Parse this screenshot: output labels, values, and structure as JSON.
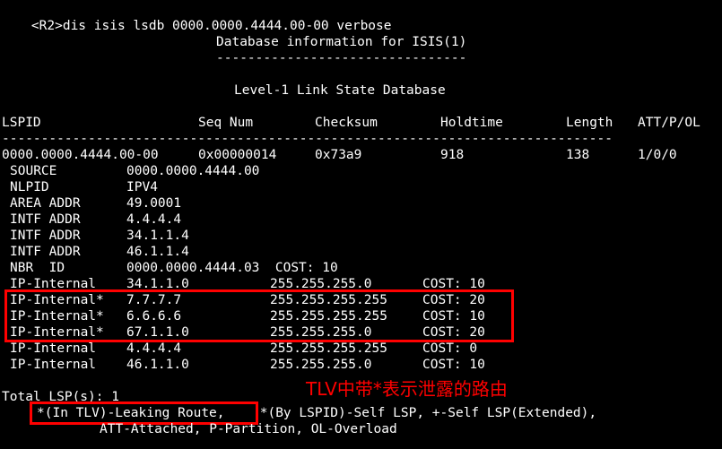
{
  "prompt": "<R2>",
  "command": "dis isis lsdb 0000.0000.4444.00-00 verbose",
  "db_title": "Database information for ISIS(1)",
  "db_underline": "--------------------------------",
  "level_title": "Level-1 Link State Database",
  "headers": {
    "lspid": "LSPID",
    "seq": "Seq Num",
    "checksum": "Checksum",
    "holdtime": "Holdtime",
    "length": "Length",
    "att": "ATT/P/OL"
  },
  "separator": "------------------------------------------------------------------------------",
  "lsp": {
    "lspid": "0000.0000.4444.00-00",
    "seq": "0x00000014",
    "checksum": "0x73a9",
    "holdtime": "918",
    "length": "138",
    "att": "1/0/0"
  },
  "details": [
    {
      "label": "SOURCE",
      "value": "0000.0000.4444.00"
    },
    {
      "label": "NLPID",
      "value": "IPV4"
    },
    {
      "label": "AREA ADDR",
      "value": "49.0001"
    },
    {
      "label": "INTF ADDR",
      "value": "4.4.4.4"
    },
    {
      "label": "INTF ADDR",
      "value": "34.1.1.4"
    },
    {
      "label": "INTF ADDR",
      "value": "46.1.1.4"
    },
    {
      "label": "NBR  ID",
      "value": "0000.0000.4444.03  COST: 10"
    }
  ],
  "routes": [
    {
      "label": "IP-Internal",
      "addr": "34.1.1.0",
      "mask": "255.255.255.0",
      "cost": "COST: 10"
    },
    {
      "label": "IP-Internal*",
      "addr": "7.7.7.7",
      "mask": "255.255.255.255",
      "cost": "COST: 20"
    },
    {
      "label": "IP-Internal*",
      "addr": "6.6.6.6",
      "mask": "255.255.255.255",
      "cost": "COST: 10"
    },
    {
      "label": "IP-Internal*",
      "addr": "67.1.1.0",
      "mask": "255.255.255.0",
      "cost": "COST: 20"
    },
    {
      "label": "IP-Internal",
      "addr": "4.4.4.4",
      "mask": "255.255.255.255",
      "cost": "COST: 0"
    },
    {
      "label": "IP-Internal",
      "addr": "46.1.1.0",
      "mask": "255.255.255.0",
      "cost": "COST: 10"
    }
  ],
  "annotation": "TLV中带*表示泄露的路由",
  "total": "Total LSP(s): 1",
  "legend_leak": "*(In TLV)-Leaking Route,",
  "legend_rest": " *(By LSPID)-Self LSP, +-Self LSP(Extended),",
  "legend_line2": "ATT-Attached, P-Partition, OL-Overload",
  "colors": {
    "background": "#000000",
    "text": "#ffffff",
    "highlight": "#ff0000"
  }
}
